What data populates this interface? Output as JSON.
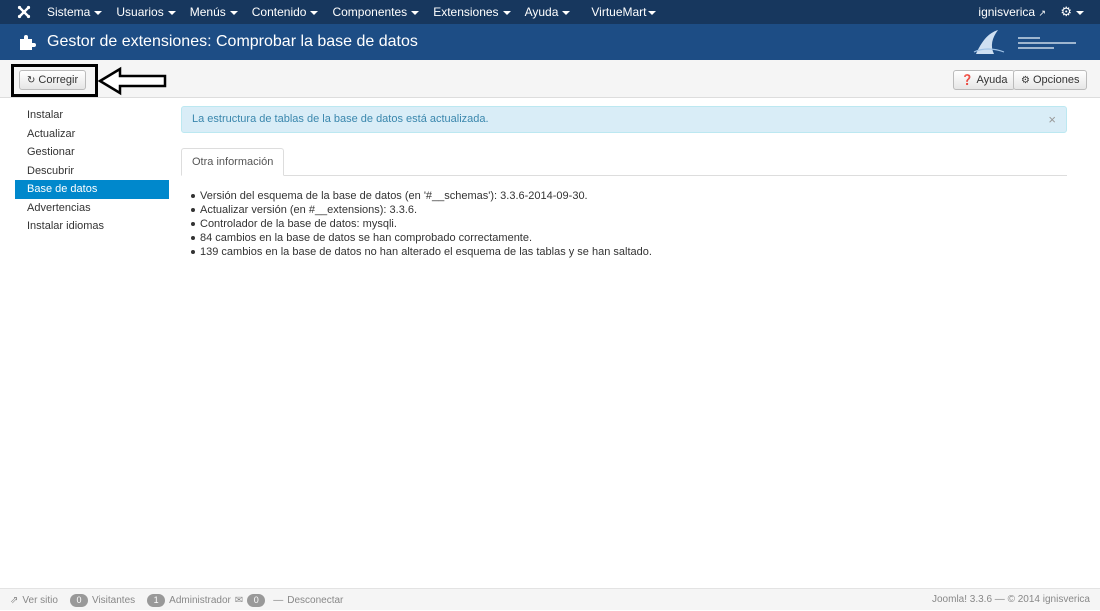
{
  "navbar": {
    "menu": [
      {
        "label": "Sistema"
      },
      {
        "label": "Usuarios"
      },
      {
        "label": "Menús"
      },
      {
        "label": "Contenido"
      },
      {
        "label": "Componentes"
      },
      {
        "label": "Extensiones"
      },
      {
        "label": "Ayuda"
      },
      {
        "label": "VirtueMart"
      }
    ],
    "user": "ignisverica",
    "logo_icon": "joomla-logo-icon",
    "gear_icon": "gear-icon"
  },
  "header": {
    "title": "Gestor de extensiones: Comprobar la base de datos"
  },
  "toolbar": {
    "fix_label": "Corregir",
    "help_label": "Ayuda",
    "options_label": "Opciones"
  },
  "sidebar": {
    "items": [
      {
        "label": "Instalar"
      },
      {
        "label": "Actualizar"
      },
      {
        "label": "Gestionar"
      },
      {
        "label": "Descubrir"
      },
      {
        "label": "Base de datos"
      },
      {
        "label": "Advertencias"
      },
      {
        "label": "Instalar idiomas"
      }
    ],
    "active_index": 4
  },
  "alert": {
    "message": "La estructura de tablas de la base de datos está actualizada.",
    "close": "×"
  },
  "tabs": [
    {
      "label": "Otra información"
    }
  ],
  "info": [
    "Versión del esquema de la base de datos (en '#__schemas'): 3.3.6-2014-09-30.",
    "Actualizar versión (en #__extensions): 3.3.6.",
    "Controlador de la base de datos: mysqli.",
    "84 cambios en la base de datos se han comprobado correctamente.",
    "139 cambios en la base de datos no han alterado el esquema de las tablas y se han saltado."
  ],
  "footer": {
    "view_site": "Ver sitio",
    "visitors_count": "0",
    "visitors_label": "Visitantes",
    "admin_count": "1",
    "admin_label": "Administrador",
    "messages_count": "0",
    "logout": "Desconectar",
    "version": "Joomla! 3.3.6 — © 2014 ignisverica"
  },
  "colors": {
    "navbar": "#17375e",
    "header": "#1d4d85",
    "active": "#0088cc",
    "alert_bg": "#d9edf7"
  }
}
